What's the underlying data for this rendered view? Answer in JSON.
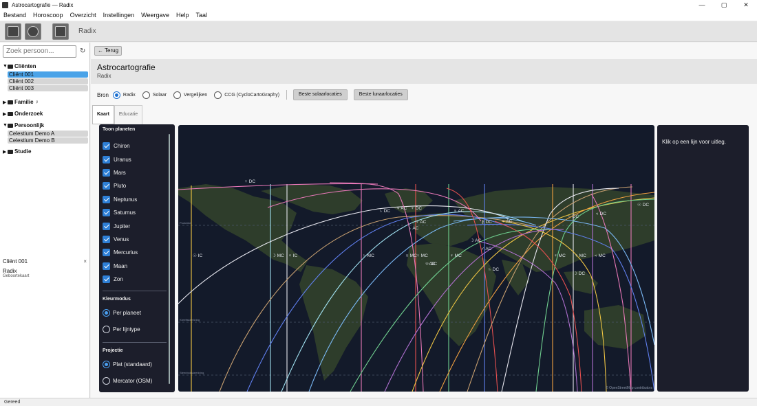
{
  "window": {
    "title": "Astrocartografie — Radix",
    "min": "—",
    "max": "▢",
    "close": "✕"
  },
  "menu": [
    "Bestand",
    "Horoscoop",
    "Overzicht",
    "Instellingen",
    "Weergave",
    "Help",
    "Taal"
  ],
  "toolbar": {
    "label": "Radix"
  },
  "sidebar": {
    "search_placeholder": "Zoek persoon...",
    "refresh_icon": "↻",
    "groups": [
      {
        "name": "Cliënten",
        "expanded": true,
        "items": [
          "Cliënt 001",
          "Cliënt 002",
          "Cliënt 003"
        ],
        "selected": 0
      },
      {
        "name": "Familie ♀",
        "expanded": false,
        "items": []
      },
      {
        "name": "Onderzoek",
        "expanded": false,
        "items": []
      },
      {
        "name": "Persoonlijk",
        "expanded": true,
        "items": [
          "Celestium Demo A",
          "Celestium Demo B"
        ]
      },
      {
        "name": "Studie",
        "expanded": false,
        "items": []
      }
    ],
    "client_panel": {
      "name": "Cliënt 001",
      "close": "×",
      "chart": "Radix",
      "sub": "Geboortekaart"
    }
  },
  "main": {
    "back_label": "← Terug",
    "title": "Astrocartografie",
    "subtitle": "Radix",
    "bron_label": "Bron",
    "sources": [
      "Radix",
      "Solaar",
      "Vergelijken",
      "CCG (CycloCartoGraphy)"
    ],
    "selected_source": 0,
    "buttons": [
      "Beste solaarlocaties",
      "Beste lunaarlocaties"
    ],
    "tabs": [
      "Kaart",
      "Educatie"
    ],
    "active_tab": 0
  },
  "planet_panel": {
    "title": "Toon planeten",
    "planets": [
      "Chiron",
      "Uranus",
      "Mars",
      "Pluto",
      "Neptunus",
      "Saturnus",
      "Jupiter",
      "Venus",
      "Mercurius",
      "Maan",
      "Zon"
    ],
    "color_mode_title": "Kleurmodus",
    "color_modes": [
      "Per planeet",
      "Per lijntype"
    ],
    "color_mode_selected": 0,
    "projection_title": "Projectie",
    "projections": [
      "Plat (standaard)",
      "Mercator (OSM)"
    ],
    "projection_selected": 0
  },
  "map": {
    "attribution": "© OpenStreetMap contributors",
    "ref_lines": [
      "Poolcirkel",
      "Kreeftskeerkring",
      "Evenaar",
      "Steenbokskeerkring"
    ],
    "line_labels": [
      "♀ DC",
      "♄ DC",
      "♃ AC",
      "♆ DC",
      "♅ AC",
      "♆ AC",
      "♄ AC",
      "☽ AC",
      "⚷ DC",
      "♀ AC",
      "☉ DC",
      "♄ DC",
      "♃ DC",
      "☉ IC",
      "☽ MC",
      "♆ IC",
      "♄ MC",
      "♅ MC",
      "♆ MC",
      "♀ AC",
      "♆ MC",
      "♀ MC",
      "♃ MC",
      "♀ MC",
      "♄ DC",
      "☽ DC",
      "♂ AC",
      "♀ DC"
    ],
    "colors": {
      "land": "#2e3d2b",
      "water": "#131a2a",
      "zon": "#f2c744",
      "maan": "#e8e8f0",
      "mercurius": "#f0a040",
      "venus": "#e878b8",
      "mars": "#e85050",
      "jupiter": "#7ab8f5",
      "saturnus": "#c8a070",
      "uranus": "#a0e0f0",
      "neptunus": "#6080f0",
      "pluto": "#b070d0",
      "chiron": "#70d090"
    }
  },
  "info_panel": {
    "text": "Klik op een lijn voor uitleg."
  },
  "status": "Gereed"
}
